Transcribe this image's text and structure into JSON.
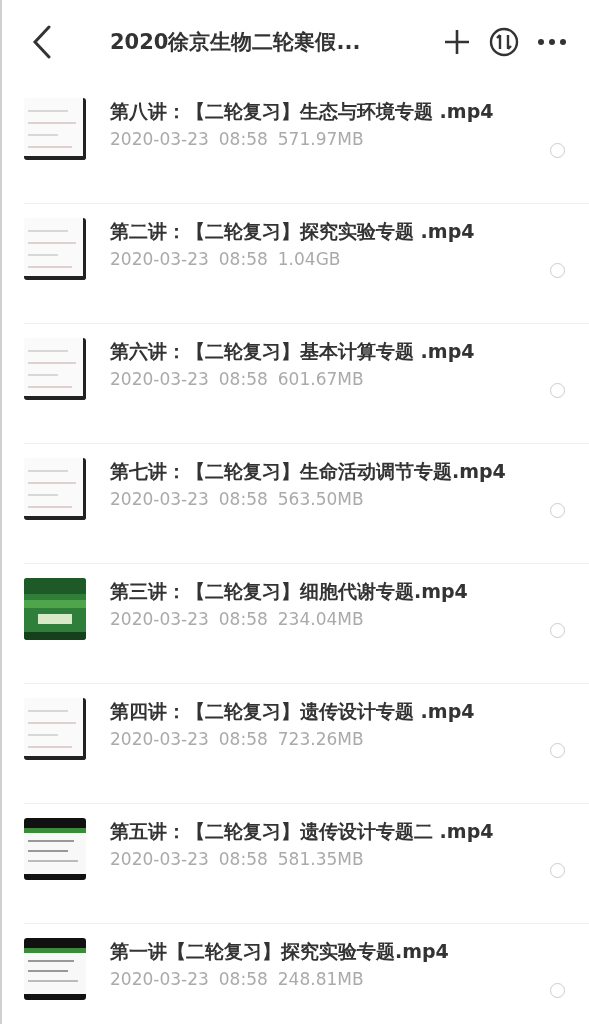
{
  "header": {
    "title": "2020徐京生物二轮寒假..."
  },
  "files": [
    {
      "name": "第八讲：【二轮复习】生态与环境专题 .mp4",
      "date": "2020-03-23",
      "time": "08:58",
      "size": "571.97MB",
      "selected": false
    },
    {
      "name": "第二讲：【二轮复习】探究实验专题 .mp4",
      "date": "2020-03-23",
      "time": "08:58",
      "size": "1.04GB",
      "selected": false
    },
    {
      "name": "第六讲：【二轮复习】基本计算专题 .mp4",
      "date": "2020-03-23",
      "time": "08:58",
      "size": "601.67MB",
      "selected": false
    },
    {
      "name": "第七讲：【二轮复习】生命活动调节专题.mp4",
      "date": "2020-03-23",
      "time": "08:58",
      "size": "563.50MB",
      "selected": false
    },
    {
      "name": "第三讲：【二轮复习】细胞代谢专题.mp4",
      "date": "2020-03-23",
      "time": "08:58",
      "size": "234.04MB",
      "selected": false
    },
    {
      "name": "第四讲：【二轮复习】遗传设计专题 .mp4",
      "date": "2020-03-23",
      "time": "08:58",
      "size": "723.26MB",
      "selected": false
    },
    {
      "name": "第五讲：【二轮复习】遗传设计专题二 .mp4",
      "date": "2020-03-23",
      "time": "08:58",
      "size": "581.35MB",
      "selected": false
    },
    {
      "name": "第一讲【二轮复习】探究实验专题.mp4",
      "date": "2020-03-23",
      "time": "08:58",
      "size": "248.81MB",
      "selected": false
    }
  ]
}
